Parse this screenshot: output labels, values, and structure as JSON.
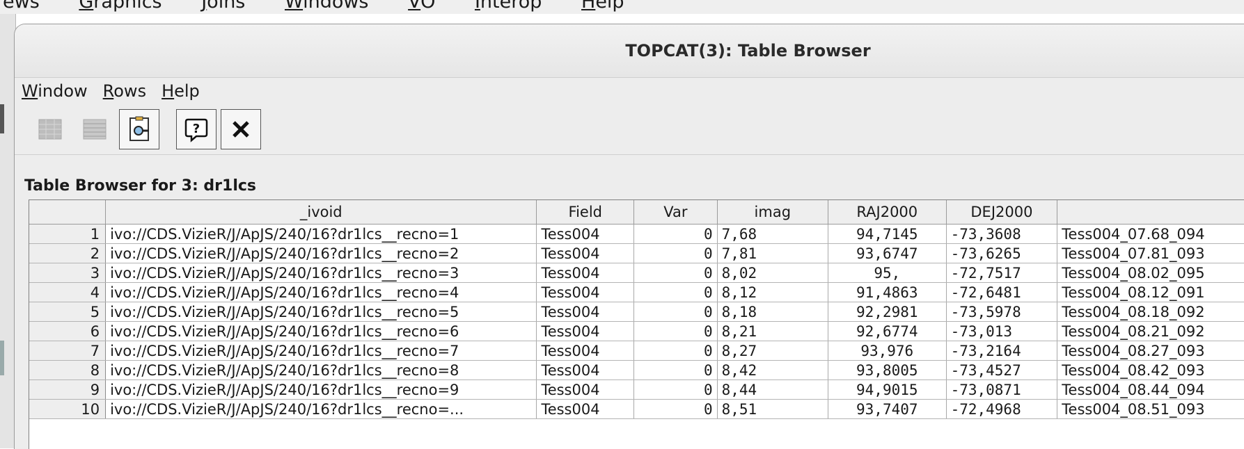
{
  "background_menu": {
    "items": [
      {
        "prefix": "",
        "mnemonic": "",
        "rest": "ews"
      },
      {
        "prefix": "",
        "mnemonic": "G",
        "rest": "raphics"
      },
      {
        "prefix": "",
        "mnemonic": "J",
        "rest": "oins"
      },
      {
        "prefix": "",
        "mnemonic": "W",
        "rest": "indows"
      },
      {
        "prefix": "",
        "mnemonic": "V",
        "rest": "O"
      },
      {
        "prefix": "",
        "mnemonic": "I",
        "rest": "nterop"
      },
      {
        "prefix": "",
        "mnemonic": "H",
        "rest": "elp"
      }
    ]
  },
  "window": {
    "title": "TOPCAT(3): Table Browser"
  },
  "menubar": {
    "items": [
      {
        "mnemonic": "W",
        "rest": "indow"
      },
      {
        "mnemonic": "R",
        "rest": "ows"
      },
      {
        "mnemonic": "H",
        "rest": "elp"
      }
    ]
  },
  "toolbar": {
    "icons": [
      "table-rows-icon-disabled",
      "table-rows-icon-disabled-2",
      "search-row-icon",
      "help-icon",
      "close-icon"
    ]
  },
  "browser_label": "Table Browser for 3: dr1lcs",
  "table": {
    "columns": [
      "",
      "_ivoid",
      "Field",
      "Var",
      "imag",
      "RAJ2000",
      "DEJ2000",
      ""
    ],
    "rows": [
      {
        "n": "1",
        "ivoid": "ivo://CDS.VizieR/J/ApJS/240/16?dr1lcs__recno=1",
        "field": "Tess004",
        "var": "0",
        "imag": "7,68",
        "ra": "94,7145",
        "de": "-73,3608",
        "name": "Tess004_07.68_094"
      },
      {
        "n": "2",
        "ivoid": "ivo://CDS.VizieR/J/ApJS/240/16?dr1lcs__recno=2",
        "field": "Tess004",
        "var": "0",
        "imag": "7,81",
        "ra": "93,6747",
        "de": "-73,6265",
        "name": "Tess004_07.81_093"
      },
      {
        "n": "3",
        "ivoid": "ivo://CDS.VizieR/J/ApJS/240/16?dr1lcs__recno=3",
        "field": "Tess004",
        "var": "0",
        "imag": "8,02",
        "ra": "95,",
        "de": "-72,7517",
        "name": "Tess004_08.02_095"
      },
      {
        "n": "4",
        "ivoid": "ivo://CDS.VizieR/J/ApJS/240/16?dr1lcs__recno=4",
        "field": "Tess004",
        "var": "0",
        "imag": "8,12",
        "ra": "91,4863",
        "de": "-72,6481",
        "name": "Tess004_08.12_091"
      },
      {
        "n": "5",
        "ivoid": "ivo://CDS.VizieR/J/ApJS/240/16?dr1lcs__recno=5",
        "field": "Tess004",
        "var": "0",
        "imag": "8,18",
        "ra": "92,2981",
        "de": "-73,5978",
        "name": "Tess004_08.18_092"
      },
      {
        "n": "6",
        "ivoid": "ivo://CDS.VizieR/J/ApJS/240/16?dr1lcs__recno=6",
        "field": "Tess004",
        "var": "0",
        "imag": "8,21",
        "ra": "92,6774",
        "de": "-73,013",
        "name": "Tess004_08.21_092"
      },
      {
        "n": "7",
        "ivoid": "ivo://CDS.VizieR/J/ApJS/240/16?dr1lcs__recno=7",
        "field": "Tess004",
        "var": "0",
        "imag": "8,27",
        "ra": "93,976",
        "de": "-73,2164",
        "name": "Tess004_08.27_093"
      },
      {
        "n": "8",
        "ivoid": "ivo://CDS.VizieR/J/ApJS/240/16?dr1lcs__recno=8",
        "field": "Tess004",
        "var": "0",
        "imag": "8,42",
        "ra": "93,8005",
        "de": "-73,4527",
        "name": "Tess004_08.42_093"
      },
      {
        "n": "9",
        "ivoid": "ivo://CDS.VizieR/J/ApJS/240/16?dr1lcs__recno=9",
        "field": "Tess004",
        "var": "0",
        "imag": "8,44",
        "ra": "94,9015",
        "de": "-73,0871",
        "name": "Tess004_08.44_094"
      },
      {
        "n": "10",
        "ivoid": "ivo://CDS.VizieR/J/ApJS/240/16?dr1lcs__recno=...",
        "field": "Tess004",
        "var": "0",
        "imag": "8,51",
        "ra": "93,7407",
        "de": "-72,4968",
        "name": "Tess004_08.51_093"
      }
    ]
  }
}
